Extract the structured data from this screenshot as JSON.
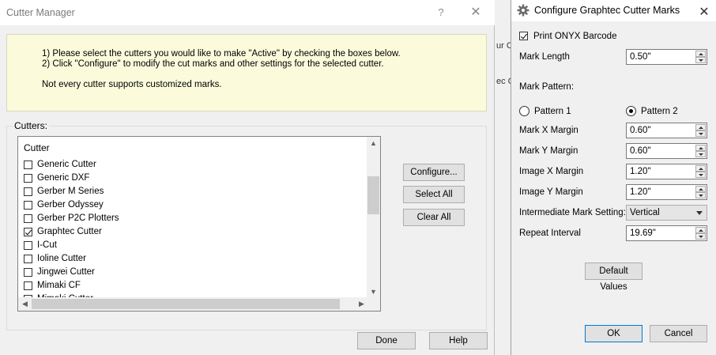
{
  "cutter_manager": {
    "title": "Cutter Manager",
    "help_glyph": "?",
    "close_glyph": "✕",
    "instructions": {
      "line1": "1) Please select the cutters you would like to make \"Active\" by checking the boxes below.",
      "line2": "2) Click \"Configure\" to modify the cut marks and other settings for the selected cutter.",
      "line3": "Not every cutter supports customized marks."
    },
    "cutters_label": "Cutters:",
    "list_header": "Cutter",
    "cutters": [
      {
        "name": "Generic Cutter",
        "checked": false
      },
      {
        "name": "Generic DXF",
        "checked": false
      },
      {
        "name": "Gerber M Series",
        "checked": false
      },
      {
        "name": "Gerber Odyssey",
        "checked": false
      },
      {
        "name": "Gerber P2C Plotters",
        "checked": false
      },
      {
        "name": "Graphtec Cutter",
        "checked": true
      },
      {
        "name": "I-Cut",
        "checked": false
      },
      {
        "name": "Ioline Cutter",
        "checked": false
      },
      {
        "name": "Jingwei Cutter",
        "checked": false
      },
      {
        "name": "Mimaki CF",
        "checked": false
      },
      {
        "name": "Mimaki Cutter",
        "checked": false
      }
    ],
    "buttons": {
      "configure": "Configure...",
      "select_all": "Select All",
      "clear_all": "Clear All",
      "done": "Done",
      "help": "Help"
    }
  },
  "background_window": {
    "fragment1": "ur Cu",
    "fragment2": "ec Cu"
  },
  "configure_dialog": {
    "title": "Configure Graphtec Cutter Marks",
    "close_glyph": "✕",
    "print_barcode": {
      "label": "Print ONYX Barcode",
      "checked": true
    },
    "mark_length": {
      "label": "Mark Length",
      "value": "0.50\""
    },
    "mark_pattern_label": "Mark Pattern:",
    "pattern_options": [
      {
        "label": "Pattern 1",
        "selected": false
      },
      {
        "label": "Pattern 2",
        "selected": true
      }
    ],
    "mark_x_margin": {
      "label": "Mark X Margin",
      "value": "0.60\""
    },
    "mark_y_margin": {
      "label": "Mark Y Margin",
      "value": "0.60\""
    },
    "image_x_margin": {
      "label": "Image X Margin",
      "value": "1.20\""
    },
    "image_y_margin": {
      "label": "Image Y Margin",
      "value": "1.20\""
    },
    "intermediate_mark": {
      "label": "Intermediate Mark Setting:",
      "value": "Vertical"
    },
    "repeat_interval": {
      "label": "Repeat Interval",
      "value": "19.69\""
    },
    "buttons": {
      "default_values": "Default Values",
      "ok": "OK",
      "cancel": "Cancel"
    },
    "colors": {
      "focus_border": "#0078d7",
      "info_background": "#fbfbdc"
    }
  }
}
